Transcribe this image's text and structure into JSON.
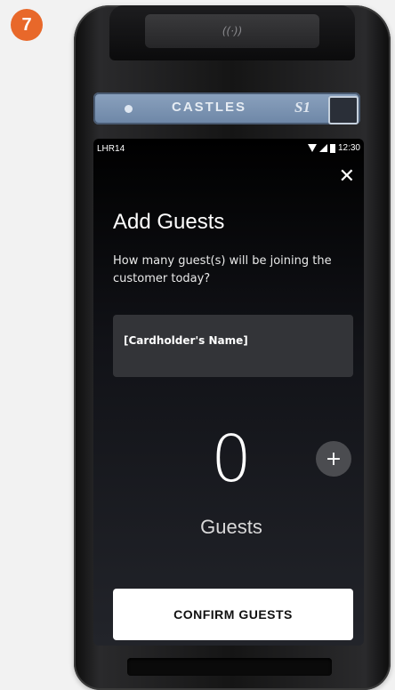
{
  "step_badge": "7",
  "device": {
    "brand": "CASTLES",
    "model": "S1",
    "nfc_label": "((·))"
  },
  "status_bar": {
    "carrier": "LHR14",
    "time": "12:30"
  },
  "screen": {
    "title": "Add Guests",
    "subtitle": "How many guest(s) will be joining the customer today?",
    "cardholder_name": "[Cardholder's Name]",
    "guest_count": "0",
    "increment_label": "+",
    "count_label": "Guests",
    "confirm_button": "CONFIRM GUESTS",
    "close_label": "✕"
  },
  "colors": {
    "badge": "#e8682a",
    "screen_bg": "#111217",
    "card_bg": "#333438",
    "confirm_bg": "#ffffff"
  }
}
